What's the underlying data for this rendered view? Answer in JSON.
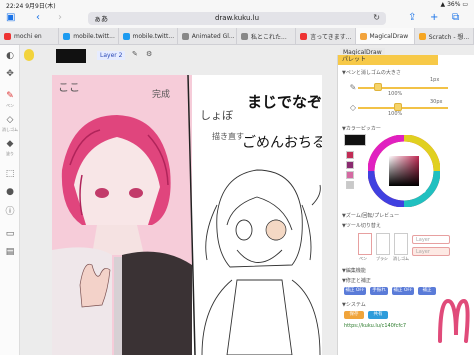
{
  "status": {
    "time": "22:24",
    "date": "9月9日(木)",
    "battery": "36%"
  },
  "browser": {
    "aa_label": "ぁあ",
    "url": "draw.kuku.lu",
    "tabs": [
      {
        "label": "mochi en",
        "fav_color": "#e33"
      },
      {
        "label": "mobile.twitt...",
        "fav_color": "#1d9bf0"
      },
      {
        "label": "mobile.twitt...",
        "fav_color": "#1d9bf0"
      },
      {
        "label": "Animated Gl...",
        "fav_color": "#888"
      },
      {
        "label": "私とこれた...",
        "fav_color": "#888"
      },
      {
        "label": "言ってきます...",
        "fav_color": "#e33"
      },
      {
        "label": "MagicalDraw",
        "fav_color": "#f2a33c",
        "active": true
      },
      {
        "label": "Scratch - 想...",
        "fav_color": "#f5a623"
      }
    ]
  },
  "app": {
    "layer_name": "Layer 2",
    "tools": [
      {
        "icon": "palette",
        "label": ""
      },
      {
        "icon": "move",
        "label": ""
      },
      {
        "icon": "pen",
        "label": "ペン"
      },
      {
        "icon": "eraser",
        "label": "消しゴム"
      },
      {
        "icon": "fill",
        "label": "塗り"
      },
      {
        "icon": "select",
        "label": ""
      },
      {
        "icon": "stamp",
        "label": ""
      }
    ],
    "panel": {
      "tab_label": "MagicalDraw",
      "header": "パレット",
      "section_pen": "▼ペンと消しゴムの大きさ",
      "size1_value": "1px",
      "size1_opacity": "100%",
      "size2_value": "30px",
      "size2_opacity": "100%",
      "section_color": "▼カラーピッカー",
      "section_zoom": "▼ズーム/回転/プレビュー",
      "section_tools": "▼ツール切り替え",
      "tool_labels": [
        "ペン",
        "ブラシ",
        "消しゴム"
      ],
      "layer_chip_1": "Layer",
      "layer_chip_2": "Layer",
      "section_edit": "▼編集機能",
      "section_fix": "▼修正と補正",
      "btn_fix_on": "補正 OFF",
      "btn_hand": "手振れ",
      "btn_stable": "補正 OFF",
      "btn_a": "補正",
      "section_system": "▼システム",
      "btn_save": "保存",
      "btn_share": "共有",
      "link": "https://kuku.lu/c140fcfc7"
    },
    "colors": {
      "accent": "#f7c948",
      "swatches": [
        "#111111",
        "#c12b55",
        "#8a2a6f",
        "#d46aa2",
        "#c9c9c9"
      ]
    }
  },
  "canvas": {
    "texts": {
      "kanji_top": "ここ",
      "memo1": "完成",
      "memo2": "しょぼ",
      "memo3": "まじでなぞ",
      "memo4": "ごめんおちる",
      "memo5": "描き直す"
    }
  }
}
